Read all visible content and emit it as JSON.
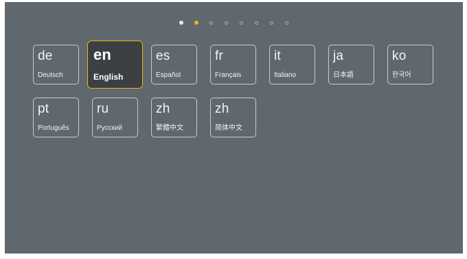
{
  "pager": {
    "page_count": 8,
    "current_page": 2
  },
  "languages": [
    {
      "code": "de",
      "name": "Deutsch"
    },
    {
      "code": "en",
      "name": "English",
      "selected": true
    },
    {
      "code": "es",
      "name": "Español"
    },
    {
      "code": "fr",
      "name": "Français"
    },
    {
      "code": "it",
      "name": "Italiano"
    },
    {
      "code": "ja",
      "name": "日本語"
    },
    {
      "code": "ko",
      "name": "한국어"
    },
    {
      "code": "pt",
      "name": "Português"
    },
    {
      "code": "ru",
      "name": "Русский"
    },
    {
      "code": "zh",
      "name": "繁體中文"
    },
    {
      "code": "zh",
      "name": "简体中文"
    }
  ],
  "colors": {
    "background": "#5f686f",
    "accent": "#f2b21b",
    "selected_tile": "#3d4043"
  }
}
